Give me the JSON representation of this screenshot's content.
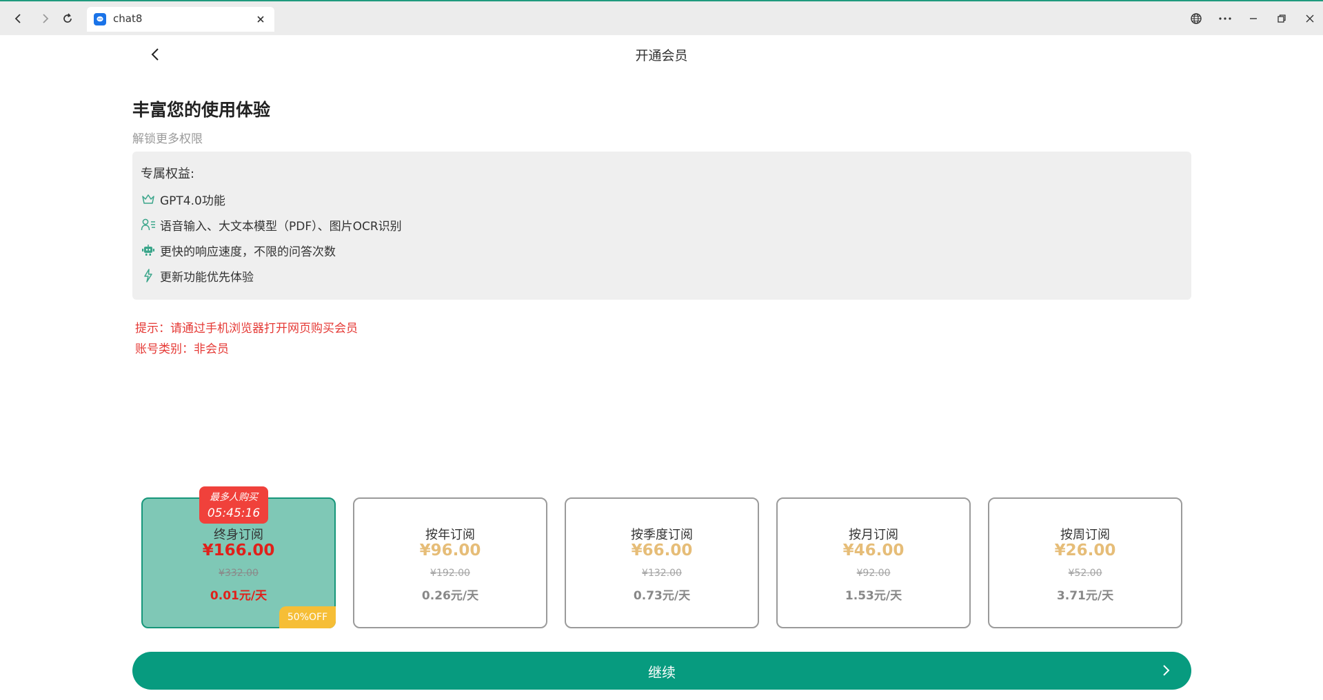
{
  "browser": {
    "tab_title": "chat8",
    "icons": [
      "back-icon",
      "forward-icon",
      "reload-icon",
      "chat-favicon",
      "close-icon",
      "globe-icon",
      "more-icon",
      "minimize-icon",
      "restore-icon",
      "window-close-icon"
    ]
  },
  "header": {
    "title": "开通会员"
  },
  "intro": {
    "headline": "丰富您的使用体验",
    "subline": "解锁更多权限"
  },
  "benefits": {
    "title": "专属权益:",
    "items": [
      {
        "icon": "crown-icon",
        "label": "GPT4.0功能"
      },
      {
        "icon": "user-list-icon",
        "label": "语音输入、大文本模型（PDF）、图片OCR识别"
      },
      {
        "icon": "robot-icon",
        "label": "更快的响应速度，不限的问答次数"
      },
      {
        "icon": "lightning-icon",
        "label": "更新功能优先体验"
      }
    ]
  },
  "notices": {
    "tip": "提示：请通过手机浏览器打开网页购买会员",
    "account": "账号类别：非会员"
  },
  "plans": [
    {
      "name": "终身订阅",
      "price": "¥166.00",
      "original": "¥332.00",
      "daily": "0.01元/天",
      "selected": true,
      "badge_line1": "最多人购买",
      "badge_line2": "05:45:16",
      "off_label": "50%OFF"
    },
    {
      "name": "按年订阅",
      "price": "¥96.00",
      "original": "¥192.00",
      "daily": "0.26元/天",
      "selected": false
    },
    {
      "name": "按季度订阅",
      "price": "¥66.00",
      "original": "¥132.00",
      "daily": "0.73元/天",
      "selected": false
    },
    {
      "name": "按月订阅",
      "price": "¥46.00",
      "original": "¥92.00",
      "daily": "1.53元/天",
      "selected": false
    },
    {
      "name": "按周订阅",
      "price": "¥26.00",
      "original": "¥52.00",
      "daily": "3.71元/天",
      "selected": false
    }
  ],
  "continue_button": {
    "label": "继续"
  },
  "colors": {
    "accent": "#079b7f",
    "selected_card": "#7fc8b6",
    "price_gold": "#e6bd78",
    "price_red": "#e0211b",
    "notice_red": "#e53935",
    "badge_red": "#f0413b",
    "off_yellow": "#f6be36"
  }
}
